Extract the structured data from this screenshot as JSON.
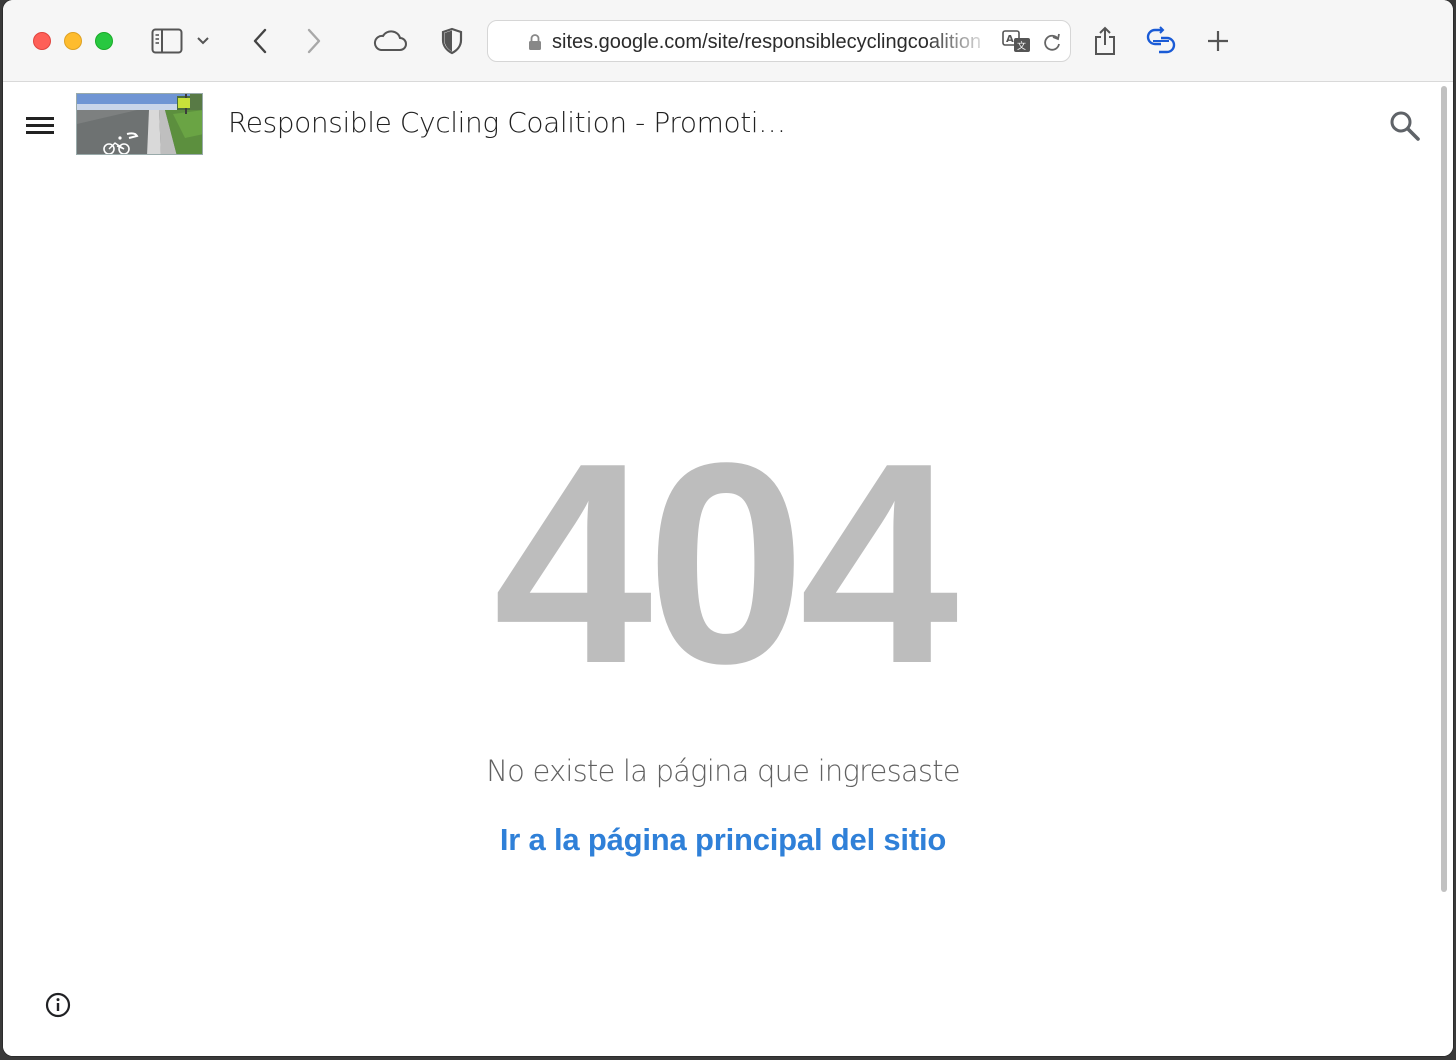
{
  "browser": {
    "url": "sites.google.com/site/responsiblecyclingcoalition",
    "icons": [
      "sidebar-icon",
      "chevron-down-icon",
      "back-icon",
      "forward-icon",
      "cloud-icon",
      "shield-icon",
      "lock-icon",
      "translate-icon",
      "reload-icon",
      "share-icon",
      "extension-icon",
      "new-tab-icon"
    ],
    "colors": {
      "close": "#fe5f57",
      "minimize": "#febc2e",
      "maximize": "#28c840",
      "extension": "#1a5bd6"
    }
  },
  "site": {
    "title": "Responsible Cycling Coalition - Promoti…",
    "icons": [
      "menu-icon",
      "search-icon",
      "info-icon"
    ]
  },
  "error": {
    "code": "404",
    "message": "No existe la página que ingresaste",
    "link_label": "Ir a la página principal del sitio",
    "colors": {
      "code": "#bdbdbd",
      "message": "#616161",
      "link": "#2f80d8"
    }
  }
}
